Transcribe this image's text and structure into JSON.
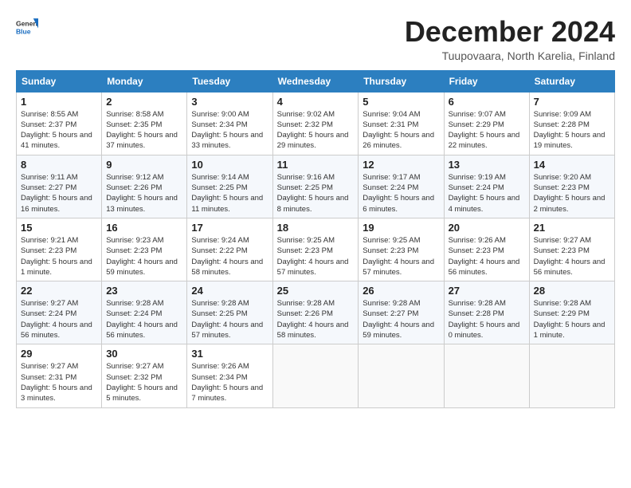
{
  "header": {
    "logo_general": "General",
    "logo_blue": "Blue",
    "title": "December 2024",
    "subtitle": "Tuupovaara, North Karelia, Finland"
  },
  "days_of_week": [
    "Sunday",
    "Monday",
    "Tuesday",
    "Wednesday",
    "Thursday",
    "Friday",
    "Saturday"
  ],
  "weeks": [
    [
      {
        "day": "1",
        "sunrise": "Sunrise: 8:55 AM",
        "sunset": "Sunset: 2:37 PM",
        "daylight": "Daylight: 5 hours and 41 minutes."
      },
      {
        "day": "2",
        "sunrise": "Sunrise: 8:58 AM",
        "sunset": "Sunset: 2:35 PM",
        "daylight": "Daylight: 5 hours and 37 minutes."
      },
      {
        "day": "3",
        "sunrise": "Sunrise: 9:00 AM",
        "sunset": "Sunset: 2:34 PM",
        "daylight": "Daylight: 5 hours and 33 minutes."
      },
      {
        "day": "4",
        "sunrise": "Sunrise: 9:02 AM",
        "sunset": "Sunset: 2:32 PM",
        "daylight": "Daylight: 5 hours and 29 minutes."
      },
      {
        "day": "5",
        "sunrise": "Sunrise: 9:04 AM",
        "sunset": "Sunset: 2:31 PM",
        "daylight": "Daylight: 5 hours and 26 minutes."
      },
      {
        "day": "6",
        "sunrise": "Sunrise: 9:07 AM",
        "sunset": "Sunset: 2:29 PM",
        "daylight": "Daylight: 5 hours and 22 minutes."
      },
      {
        "day": "7",
        "sunrise": "Sunrise: 9:09 AM",
        "sunset": "Sunset: 2:28 PM",
        "daylight": "Daylight: 5 hours and 19 minutes."
      }
    ],
    [
      {
        "day": "8",
        "sunrise": "Sunrise: 9:11 AM",
        "sunset": "Sunset: 2:27 PM",
        "daylight": "Daylight: 5 hours and 16 minutes."
      },
      {
        "day": "9",
        "sunrise": "Sunrise: 9:12 AM",
        "sunset": "Sunset: 2:26 PM",
        "daylight": "Daylight: 5 hours and 13 minutes."
      },
      {
        "day": "10",
        "sunrise": "Sunrise: 9:14 AM",
        "sunset": "Sunset: 2:25 PM",
        "daylight": "Daylight: 5 hours and 11 minutes."
      },
      {
        "day": "11",
        "sunrise": "Sunrise: 9:16 AM",
        "sunset": "Sunset: 2:25 PM",
        "daylight": "Daylight: 5 hours and 8 minutes."
      },
      {
        "day": "12",
        "sunrise": "Sunrise: 9:17 AM",
        "sunset": "Sunset: 2:24 PM",
        "daylight": "Daylight: 5 hours and 6 minutes."
      },
      {
        "day": "13",
        "sunrise": "Sunrise: 9:19 AM",
        "sunset": "Sunset: 2:24 PM",
        "daylight": "Daylight: 5 hours and 4 minutes."
      },
      {
        "day": "14",
        "sunrise": "Sunrise: 9:20 AM",
        "sunset": "Sunset: 2:23 PM",
        "daylight": "Daylight: 5 hours and 2 minutes."
      }
    ],
    [
      {
        "day": "15",
        "sunrise": "Sunrise: 9:21 AM",
        "sunset": "Sunset: 2:23 PM",
        "daylight": "Daylight: 5 hours and 1 minute."
      },
      {
        "day": "16",
        "sunrise": "Sunrise: 9:23 AM",
        "sunset": "Sunset: 2:23 PM",
        "daylight": "Daylight: 4 hours and 59 minutes."
      },
      {
        "day": "17",
        "sunrise": "Sunrise: 9:24 AM",
        "sunset": "Sunset: 2:22 PM",
        "daylight": "Daylight: 4 hours and 58 minutes."
      },
      {
        "day": "18",
        "sunrise": "Sunrise: 9:25 AM",
        "sunset": "Sunset: 2:23 PM",
        "daylight": "Daylight: 4 hours and 57 minutes."
      },
      {
        "day": "19",
        "sunrise": "Sunrise: 9:25 AM",
        "sunset": "Sunset: 2:23 PM",
        "daylight": "Daylight: 4 hours and 57 minutes."
      },
      {
        "day": "20",
        "sunrise": "Sunrise: 9:26 AM",
        "sunset": "Sunset: 2:23 PM",
        "daylight": "Daylight: 4 hours and 56 minutes."
      },
      {
        "day": "21",
        "sunrise": "Sunrise: 9:27 AM",
        "sunset": "Sunset: 2:23 PM",
        "daylight": "Daylight: 4 hours and 56 minutes."
      }
    ],
    [
      {
        "day": "22",
        "sunrise": "Sunrise: 9:27 AM",
        "sunset": "Sunset: 2:24 PM",
        "daylight": "Daylight: 4 hours and 56 minutes."
      },
      {
        "day": "23",
        "sunrise": "Sunrise: 9:28 AM",
        "sunset": "Sunset: 2:24 PM",
        "daylight": "Daylight: 4 hours and 56 minutes."
      },
      {
        "day": "24",
        "sunrise": "Sunrise: 9:28 AM",
        "sunset": "Sunset: 2:25 PM",
        "daylight": "Daylight: 4 hours and 57 minutes."
      },
      {
        "day": "25",
        "sunrise": "Sunrise: 9:28 AM",
        "sunset": "Sunset: 2:26 PM",
        "daylight": "Daylight: 4 hours and 58 minutes."
      },
      {
        "day": "26",
        "sunrise": "Sunrise: 9:28 AM",
        "sunset": "Sunset: 2:27 PM",
        "daylight": "Daylight: 4 hours and 59 minutes."
      },
      {
        "day": "27",
        "sunrise": "Sunrise: 9:28 AM",
        "sunset": "Sunset: 2:28 PM",
        "daylight": "Daylight: 5 hours and 0 minutes."
      },
      {
        "day": "28",
        "sunrise": "Sunrise: 9:28 AM",
        "sunset": "Sunset: 2:29 PM",
        "daylight": "Daylight: 5 hours and 1 minute."
      }
    ],
    [
      {
        "day": "29",
        "sunrise": "Sunrise: 9:27 AM",
        "sunset": "Sunset: 2:31 PM",
        "daylight": "Daylight: 5 hours and 3 minutes."
      },
      {
        "day": "30",
        "sunrise": "Sunrise: 9:27 AM",
        "sunset": "Sunset: 2:32 PM",
        "daylight": "Daylight: 5 hours and 5 minutes."
      },
      {
        "day": "31",
        "sunrise": "Sunrise: 9:26 AM",
        "sunset": "Sunset: 2:34 PM",
        "daylight": "Daylight: 5 hours and 7 minutes."
      },
      null,
      null,
      null,
      null
    ]
  ]
}
